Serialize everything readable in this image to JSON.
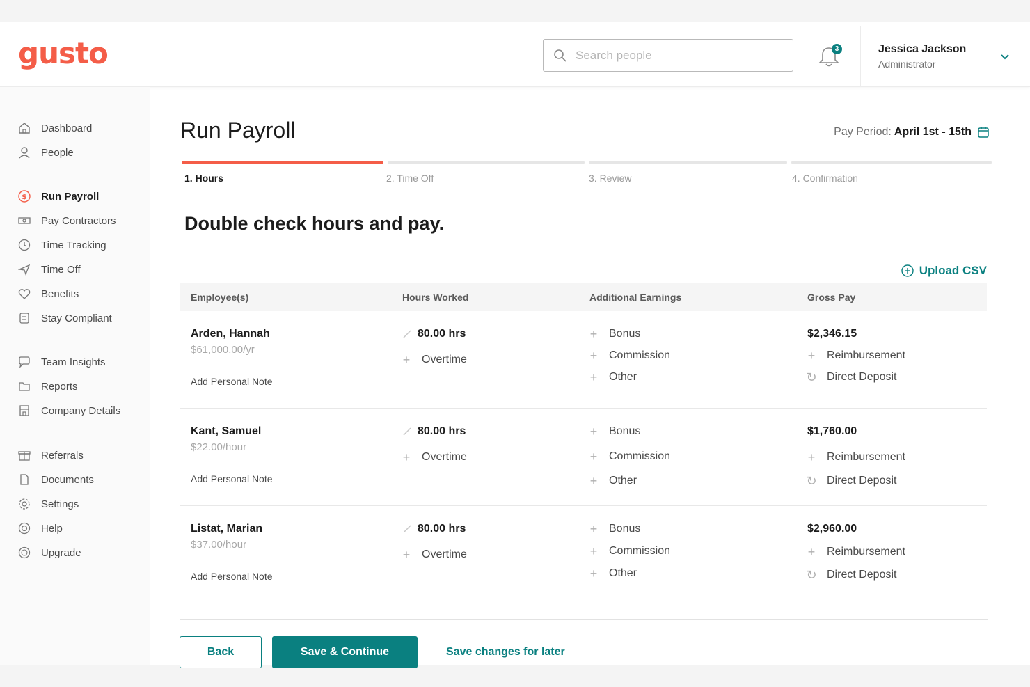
{
  "header": {
    "logo": "gusto",
    "search_placeholder": "Search people",
    "notification_count": "3",
    "user_name": "Jessica Jackson",
    "user_role": "Administrator"
  },
  "sidebar": {
    "items": [
      {
        "label": "Dashboard",
        "icon": "home-icon"
      },
      {
        "label": "People",
        "icon": "person-icon"
      },
      {
        "label": "Run Payroll",
        "icon": "dollar-icon",
        "active": true
      },
      {
        "label": "Pay Contractors",
        "icon": "cash-icon"
      },
      {
        "label": "Time Tracking",
        "icon": "clock-icon"
      },
      {
        "label": "Time Off",
        "icon": "plane-icon"
      },
      {
        "label": "Benefits",
        "icon": "heart-icon"
      },
      {
        "label": "Stay Compliant",
        "icon": "compliance-icon"
      },
      {
        "label": "Team Insights",
        "icon": "chat-icon"
      },
      {
        "label": "Reports",
        "icon": "folder-icon"
      },
      {
        "label": "Company Details",
        "icon": "building-icon"
      },
      {
        "label": "Referrals",
        "icon": "gift-icon"
      },
      {
        "label": "Documents",
        "icon": "document-icon"
      },
      {
        "label": "Settings",
        "icon": "gear-icon"
      },
      {
        "label": "Help",
        "icon": "lifebuoy-icon"
      },
      {
        "label": "Upgrade",
        "icon": "upgrade-icon"
      }
    ]
  },
  "main": {
    "title": "Run Payroll",
    "pay_period_label": "Pay Period:",
    "pay_period_value": "April 1st - 15th",
    "steps": [
      "1. Hours",
      "2. Time Off",
      "3. Review",
      "4. Confirmation"
    ],
    "active_step": 0,
    "subtitle": "Double check hours and pay.",
    "upload_label": "Upload CSV",
    "columns": [
      "Employee(s)",
      "Hours Worked",
      "Additional Earnings",
      "Gross Pay"
    ],
    "rows": [
      {
        "name": "Arden, Hannah",
        "rate": "$61,000.00/yr",
        "note": "Add Personal Note",
        "hours": "80.00 hrs",
        "overtime": "Overtime",
        "bonus": "Bonus",
        "commission": "Commission",
        "other": "Other",
        "gross": "$2,346.15",
        "reimbursement": "Reimbursement",
        "payment": "Direct Deposit"
      },
      {
        "name": "Kant, Samuel",
        "rate": "$22.00/hour",
        "note": "Add Personal Note",
        "hours": "80.00 hrs",
        "overtime": "Overtime",
        "bonus": "Bonus",
        "commission": "Commission",
        "other": "Other",
        "gross": "$1,760.00",
        "reimbursement": "Reimbursement",
        "payment": "Direct Deposit"
      },
      {
        "name": "Listat, Marian",
        "rate": "$37.00/hour",
        "note": "Add Personal Note",
        "hours": "80.00 hrs",
        "overtime": "Overtime",
        "bonus": "Bonus",
        "commission": "Commission",
        "other": "Other",
        "gross": "$2,960.00",
        "reimbursement": "Reimbursement",
        "payment": "Direct Deposit"
      }
    ],
    "back_label": "Back",
    "save_label": "Save & Continue",
    "later_label": "Save changes for later"
  },
  "colors": {
    "brand": "#f45d48",
    "accent": "#0a8080"
  }
}
